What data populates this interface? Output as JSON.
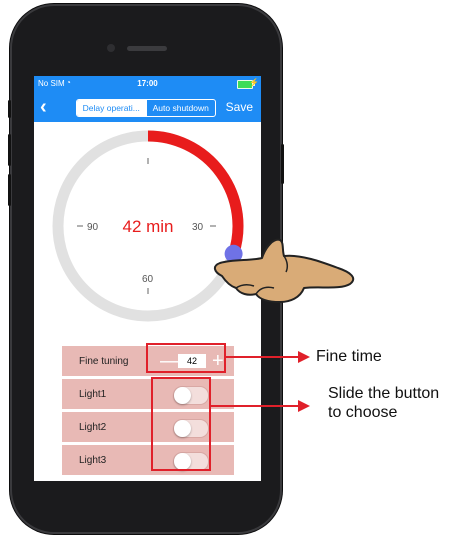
{
  "status_bar": {
    "carrier": "No SIM",
    "time": "17:00"
  },
  "nav": {
    "tabs": [
      {
        "label": "Delay operati...",
        "active": true
      },
      {
        "label": "Auto shutdown",
        "active": false
      }
    ],
    "save_label": "Save"
  },
  "dial": {
    "value_text": "42 min",
    "ticks": {
      "left": "90",
      "right": "30",
      "bottom": "60"
    },
    "progress_fraction": 0.3,
    "colors": {
      "progress": "#e81c1c",
      "track": "#e1e1e1",
      "thumb": "#6f72e6"
    }
  },
  "fine_tuning": {
    "label": "Fine tuning",
    "minus": "—",
    "value": "42",
    "plus": "+"
  },
  "lights": [
    {
      "label": "Light1",
      "on": false
    },
    {
      "label": "Light2",
      "on": false
    },
    {
      "label": "Light3",
      "on": false
    }
  ],
  "annotations": {
    "fine_time": "Fine time",
    "slide_line1": "Slide the button",
    "slide_line2": "to choose",
    "color": "#e0202a"
  },
  "colors": {
    "nav_blue": "#1e8cf5",
    "row_bg": "#e8b9b5",
    "accent_red": "#e81c1c"
  }
}
